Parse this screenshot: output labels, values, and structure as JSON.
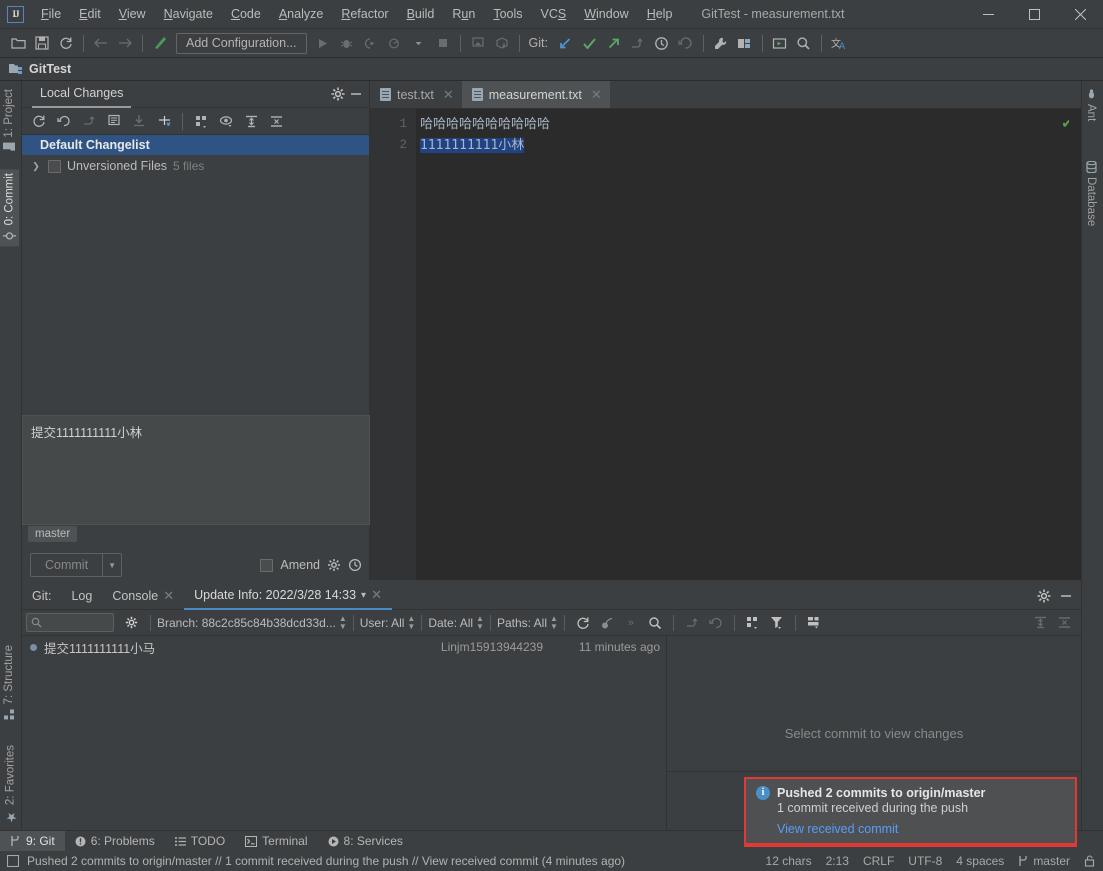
{
  "window": {
    "title": "GitTest - measurement.txt",
    "logo_text": "IJ",
    "minimize": "—",
    "maximize": "□",
    "close": "✕"
  },
  "menubar": {
    "items": [
      {
        "label": "File",
        "mnemonic": "F"
      },
      {
        "label": "Edit",
        "mnemonic": "E"
      },
      {
        "label": "View",
        "mnemonic": "V"
      },
      {
        "label": "Navigate",
        "mnemonic": "N"
      },
      {
        "label": "Code",
        "mnemonic": "C"
      },
      {
        "label": "Analyze",
        "mnemonic": "A"
      },
      {
        "label": "Refactor",
        "mnemonic": "R"
      },
      {
        "label": "Build",
        "mnemonic": "B"
      },
      {
        "label": "Run",
        "mnemonic": "u"
      },
      {
        "label": "Tools",
        "mnemonic": "T"
      },
      {
        "label": "VCS",
        "mnemonic": "S"
      },
      {
        "label": "Window",
        "mnemonic": "W"
      },
      {
        "label": "Help",
        "mnemonic": "H"
      }
    ]
  },
  "toolbar": {
    "run_configuration": "Add Configuration...",
    "git_label": "Git:",
    "icons": [
      "open-folder-icon",
      "save-all-icon",
      "sync-icon",
      "back-icon",
      "forward-icon",
      "build-icon"
    ],
    "git_icons": [
      "update-project-icon",
      "commit-icon",
      "push-icon",
      "branch-icon",
      "history-icon",
      "rollback-icon"
    ],
    "right_icons": [
      "settings-wrench-icon",
      "project-structure-icon",
      "run-anything-icon",
      "search-everywhere-icon",
      "translate-icon"
    ]
  },
  "project_bar": {
    "name": "GitTest",
    "icon": "project-folder-icon"
  },
  "left_stripe": {
    "tabs": [
      {
        "label": "1: Project",
        "icon": "project-icon"
      },
      {
        "label": "0: Commit",
        "icon": "commit-icon",
        "active": true
      },
      {
        "label": "7: Structure",
        "icon": "structure-icon"
      },
      {
        "label": "2: Favorites",
        "icon": "star-icon"
      }
    ]
  },
  "right_stripe": {
    "tabs": [
      {
        "label": "Ant",
        "icon": "ant-icon"
      },
      {
        "label": "Database",
        "icon": "database-icon"
      }
    ]
  },
  "local_changes": {
    "tab_label": "Local Changes",
    "gear_icon": "gear-icon",
    "minimize_icon": "minimize-icon",
    "toolbar_icons": [
      "refresh-icon",
      "rollback-icon",
      "shelve-icon",
      "diff-icon",
      "get-from-vcs-icon",
      "resolve-conflicts-icon",
      "group-by-icon",
      "preview-icon",
      "expand-all-icon",
      "collapse-all-icon"
    ],
    "changelist_name": "Default Changelist",
    "rows": [
      {
        "label": "Unversioned Files",
        "count": "5 files",
        "expanded": false
      }
    ]
  },
  "commit": {
    "message": "提交1111111111小林",
    "branch_chip": "master",
    "button_label": "Commit",
    "dropdown_icon": "chevron-down-icon",
    "amend_label": "Amend",
    "amend_checked": false,
    "gear_icon": "gear-icon",
    "history_icon": "history-icon"
  },
  "editor": {
    "tabs": [
      {
        "label": "test.txt",
        "active": false,
        "icon": "text-file-icon",
        "close": "✕"
      },
      {
        "label": "measurement.txt",
        "active": true,
        "icon": "text-file-icon",
        "close": "✕"
      }
    ],
    "line_numbers": [
      "1",
      "2"
    ],
    "lines": [
      {
        "text": "哈哈哈哈哈哈哈哈哈哈",
        "selected": false
      },
      {
        "text": "1111111111小林",
        "selected": true
      }
    ],
    "inspection_status": "✔",
    "selection_color": "#214283"
  },
  "git_tool": {
    "tabs": [
      {
        "label": "Git:",
        "active": false,
        "closable": false
      },
      {
        "label": "Log",
        "active": false,
        "closable": false
      },
      {
        "label": "Console",
        "active": false,
        "closable": true,
        "close": "✕"
      },
      {
        "label": "Update Info: 2022/3/28 14:33",
        "active": true,
        "closable": true,
        "close": "✕",
        "dropdown": "▾"
      }
    ],
    "gear_icon": "gear-icon",
    "minimize_icon": "minimize-icon",
    "filters": {
      "search_placeholder": "Q․",
      "search_icon": "search-icon",
      "settings_icon": "gear-icon",
      "branch": "Branch: 88c2c85c84b38dcd33d...",
      "user": "User: All",
      "date": "Date: All",
      "paths": "Paths: All",
      "refresh_icon": "refresh-icon",
      "cherry_pick_icon": "cherry-pick-icon",
      "more_icon": "»",
      "find_icon": "search-icon"
    },
    "right_toolbar_icons": [
      "go-to-change-icon",
      "revert-icon",
      "group-by-icon",
      "filter-icon",
      "view-options-icon",
      "expand-all-icon",
      "collapse-all-icon"
    ],
    "commits": [
      {
        "subject": "提交1111111111小马",
        "author": "Linjm15913944239",
        "date": "11 minutes ago"
      }
    ],
    "changes_placeholder": "Select commit to view changes"
  },
  "notification": {
    "icon": "info-icon",
    "icon_glyph": "i",
    "title": "Pushed 2 commits to origin/master",
    "subtitle": "1 commit received during the push",
    "link": "View received commit",
    "border_color": "#e03a32"
  },
  "bottom_stripe": {
    "tabs": [
      {
        "label": "9: Git",
        "icon": "branch-icon",
        "active": true
      },
      {
        "label": "6: Problems",
        "icon": "problems-icon",
        "active": false
      },
      {
        "label": "TODO",
        "icon": "todo-icon",
        "active": false
      },
      {
        "label": "Terminal",
        "icon": "terminal-icon",
        "active": false
      },
      {
        "label": "8: Services",
        "icon": "services-icon",
        "active": false
      }
    ]
  },
  "statusbar": {
    "icon": "event-log-icon",
    "message": "Pushed 2 commits to origin/master // 1 commit received during the push // View received commit (4 minutes ago)",
    "chars": "12 chars",
    "caret": "2:13",
    "line_separator": "CRLF",
    "encoding": "UTF-8",
    "indent": "4 spaces",
    "branch": "master",
    "branch_icon": "branch-icon",
    "lock_icon": "lock-icon"
  }
}
